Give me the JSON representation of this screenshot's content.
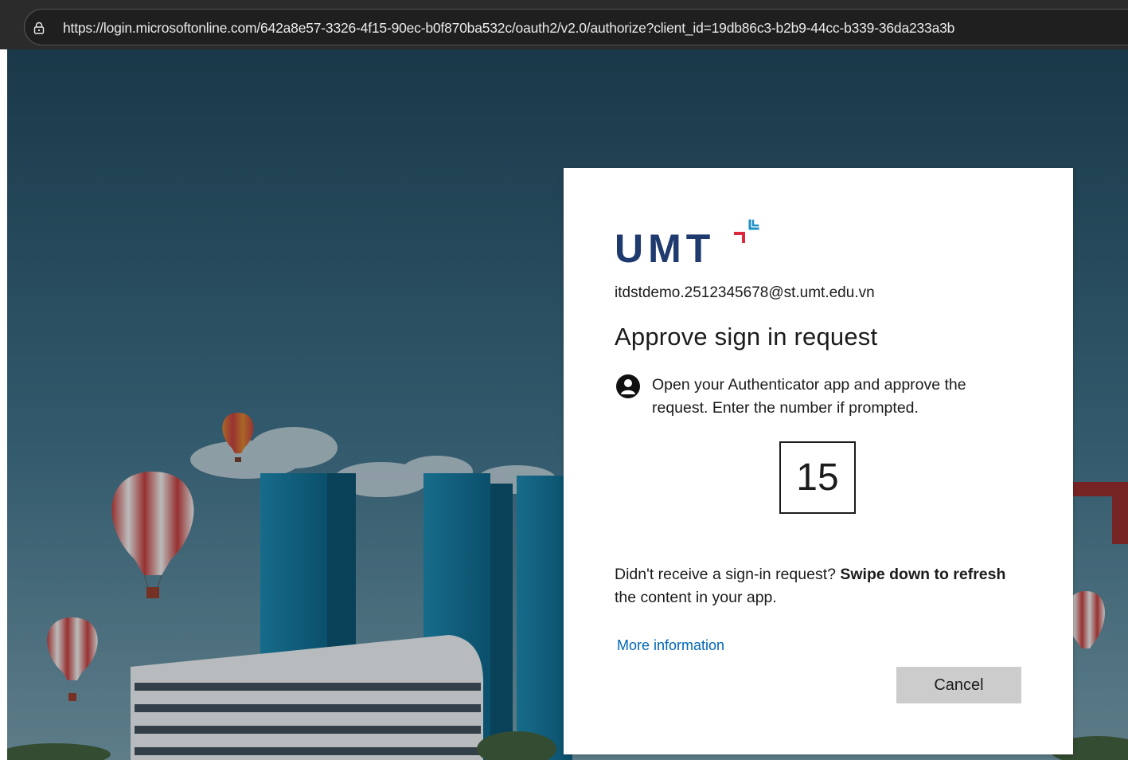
{
  "browser": {
    "url": "https://login.microsoftonline.com/642a8e57-3326-4f15-90ec-b0f870ba532c/oauth2/v2.0/authorize?client_id=19db86c3-b2b9-44cc-b339-36da233a3b"
  },
  "card": {
    "logo_text": "UMT",
    "email": "itdstdemo.2512345678@st.umt.edu.vn",
    "title": "Approve sign in request",
    "instruction": "Open your Authenticator app and approve the request. Enter the number if prompted.",
    "number": "15",
    "help_prefix": "Didn't receive a sign-in request? ",
    "help_bold_1": "Swipe down to refresh",
    "help_suffix": " the content in your app.",
    "more_info_label": "More information",
    "cancel_label": "Cancel"
  },
  "colors": {
    "logo_navy": "#1e3a6e",
    "logo_red": "#e0283c",
    "link_blue": "#0067b8",
    "button_gray": "#cccccc"
  },
  "icons": {
    "address_bar": "lock-icon",
    "instruction": "authenticator-person-icon"
  }
}
